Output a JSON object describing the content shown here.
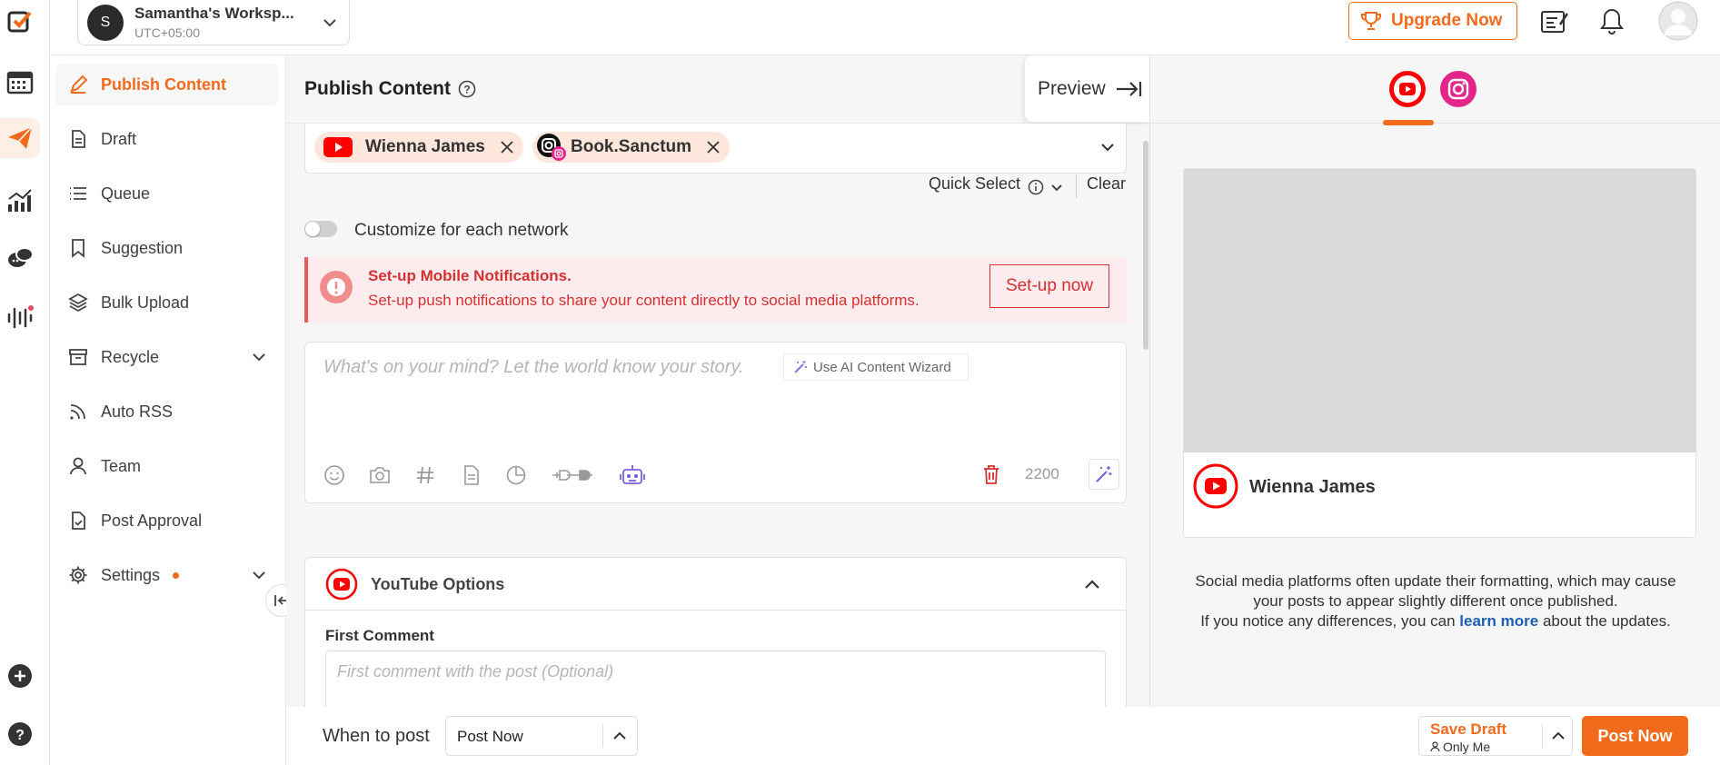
{
  "workspace": {
    "initial": "S",
    "name": "Samantha's Worksp...",
    "timezone": "UTC+05:00"
  },
  "topbar": {
    "upgrade_label": "Upgrade Now"
  },
  "sidebar": {
    "items": [
      {
        "label": "Publish Content",
        "icon": "pen-icon",
        "active": true
      },
      {
        "label": "Draft",
        "icon": "document-icon"
      },
      {
        "label": "Queue",
        "icon": "list-icon"
      },
      {
        "label": "Suggestion",
        "icon": "bookmark-icon"
      },
      {
        "label": "Bulk Upload",
        "icon": "layers-icon"
      },
      {
        "label": "Recycle",
        "icon": "archive-icon",
        "expandable": true
      },
      {
        "label": "Auto RSS",
        "icon": "rss-icon"
      },
      {
        "label": "Team",
        "icon": "user-icon"
      },
      {
        "label": "Post Approval",
        "icon": "file-check-icon"
      },
      {
        "label": "Settings",
        "icon": "gear-icon",
        "expandable": true,
        "badge_dot": true
      }
    ]
  },
  "main": {
    "title": "Publish Content",
    "preview_label": "Preview",
    "accounts": [
      {
        "name": "Wienna James",
        "network": "youtube"
      },
      {
        "name": "Book.Sanctum",
        "network": "instagram"
      }
    ],
    "quick_select_label": "Quick Select",
    "clear_label": "Clear",
    "customize_label": "Customize for each network",
    "alert": {
      "title": "Set-up Mobile Notifications.",
      "message": "Set-up push notifications to share your content directly to social media platforms.",
      "button": "Set-up now"
    },
    "editor": {
      "placeholder": "What's on your mind? Let the world know your story.",
      "ai_wizard_label": "Use AI Content Wizard",
      "char_count": "2200"
    },
    "youtube_options": {
      "title": "YouTube Options",
      "first_comment_label": "First Comment",
      "first_comment_placeholder": "First comment with the post (Optional)"
    }
  },
  "preview": {
    "account_name": "Wienna James",
    "note_line1": "Social media platforms often update their formatting, which may cause",
    "note_line2": "your posts to appear slightly different once published.",
    "note_line3": "If you notice any differences, you can",
    "link": "learn more",
    "note_line4": "about the updates."
  },
  "bottom": {
    "when_label": "When to post",
    "when_value": "Post Now",
    "save_draft": "Save Draft",
    "visibility": "Only Me",
    "post_now": "Post Now"
  },
  "colors": {
    "accent": "#f26b1d",
    "youtube": "#ff0000",
    "instagram": "#e4258a",
    "alert": "#d63031"
  }
}
